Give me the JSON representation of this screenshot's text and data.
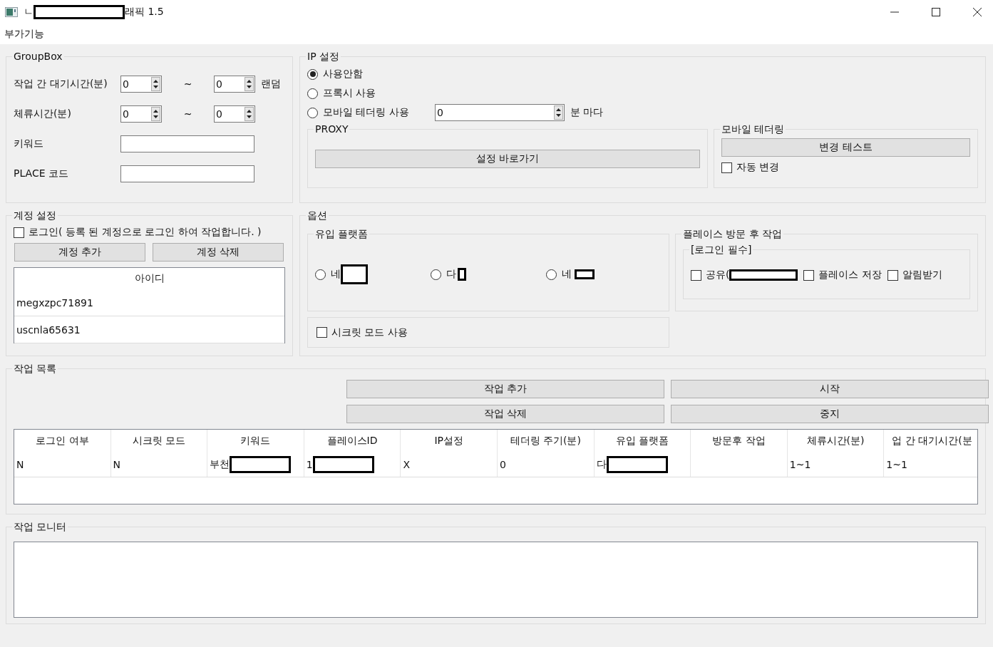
{
  "window": {
    "title_start": "ㄴ",
    "title_redacted": true,
    "title_end": "래픽 1.5"
  },
  "menu": [
    "부가기능"
  ],
  "groupbox": {
    "title": "GroupBox",
    "rows": [
      {
        "kind": "range",
        "label": "작업 간 대기시간(분)",
        "from": "0",
        "separator": "~",
        "to": "0",
        "suffix": "랜덤"
      },
      {
        "kind": "range",
        "label": "체류시간(분)",
        "from": "0",
        "separator": "~",
        "to": "0"
      },
      {
        "kind": "text",
        "label": "키워드"
      },
      {
        "kind": "text",
        "label": "PLACE 코드"
      }
    ]
  },
  "ip": {
    "title": "IP 설정",
    "options": [
      {
        "label": "사용안함",
        "selected": true
      },
      {
        "label": "프록시 사용",
        "selected": false
      },
      {
        "label": "모바일 테더링 사용",
        "selected": false
      }
    ],
    "interval_value": "0",
    "interval_suffix": "분 마다",
    "proxy": {
      "title": "PROXY",
      "button": "설정 바로가기"
    },
    "tethering": {
      "title": "모바일 테더링",
      "button": "변경 테스트",
      "auto_change": {
        "label": "자동 변경",
        "checked": false
      }
    }
  },
  "account": {
    "title": "계정 설정",
    "login": {
      "label": "로그인( 등록 된 계정으로 로그인 하여 작업합니다. )",
      "checked": false
    },
    "buttons": [
      "계정 추가",
      "계정 삭제"
    ],
    "column": "아이디",
    "rows": [
      "megxzpc71891",
      "uscnla65631"
    ]
  },
  "options": {
    "title": "옵션",
    "platform": {
      "title": "유입 플랫폼",
      "choices": [
        {
          "label": "네",
          "redacted": true,
          "selected": false
        },
        {
          "label": "다",
          "redacted": true,
          "selected": false
        },
        {
          "label": "네",
          "redacted": true,
          "selected": false
        }
      ]
    },
    "secret_mode": {
      "label": "시크릿 모드 사용",
      "checked": false
    },
    "after_visit": {
      "title": "플레이스 방문 후 작업",
      "subtitle": "[로그인 필수]",
      "checks": [
        {
          "label": "공유(",
          "redacted": true,
          "checked": false
        },
        {
          "label": "플레이스 저장",
          "redacted": false,
          "checked": false
        },
        {
          "label": "알림받기",
          "redacted": false,
          "checked": false
        }
      ]
    }
  },
  "tasks": {
    "title": "작업 목록",
    "buttons": [
      "작업 추가",
      "시작",
      "작업 삭제",
      "중지"
    ],
    "table": {
      "columns": [
        "로그인 여부",
        "시크릿 모드",
        "키워드",
        "플레이스ID",
        "IP설정",
        "테더링 주기(분)",
        "유입 플랫폼",
        "방문후 작업",
        "체류시간(분)",
        "업 간 대기시간(분"
      ],
      "rows": [
        [
          {
            "text": "N",
            "redacted": false
          },
          {
            "text": "N",
            "redacted": false
          },
          {
            "text": "부천",
            "redacted": true
          },
          {
            "text": "1",
            "redacted": true
          },
          {
            "text": "X",
            "redacted": false
          },
          {
            "text": "0",
            "redacted": false
          },
          {
            "text": "다",
            "redacted": true
          },
          {
            "redacted": false
          },
          {
            "text": "1~1",
            "redacted": false
          },
          {
            "text": "1~1",
            "redacted": false
          }
        ]
      ]
    }
  },
  "monitor": {
    "title": "작업 모니터"
  }
}
